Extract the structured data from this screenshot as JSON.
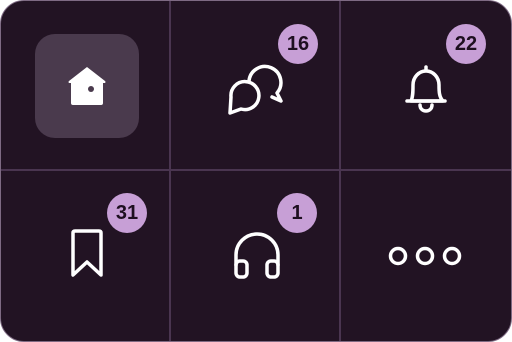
{
  "tiles": [
    {
      "name": "home",
      "icon": "home-icon",
      "active": true
    },
    {
      "name": "messages",
      "icon": "chat-bubbles-icon",
      "badge": "16"
    },
    {
      "name": "notifications",
      "icon": "bell-icon",
      "badge": "22"
    },
    {
      "name": "bookmarks",
      "icon": "bookmark-icon",
      "badge": "31"
    },
    {
      "name": "audio",
      "icon": "headphones-icon",
      "badge": "1"
    },
    {
      "name": "more",
      "icon": "more-dots-icon"
    }
  ],
  "colors": {
    "background": "#221323",
    "border": "#7e6a83",
    "divider": "#4a3550",
    "active_tile": "#4a3a4d",
    "badge": "#c79fd6",
    "badge_text": "#1e0f20",
    "icon": "#ffffff"
  }
}
